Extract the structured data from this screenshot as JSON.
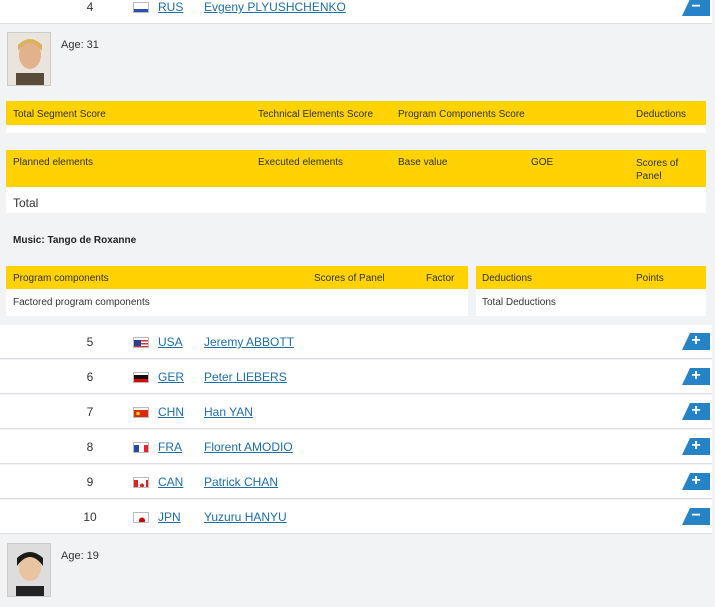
{
  "top_row": {
    "rank": "4",
    "noc": "RUS",
    "name": "Evgeny PLYUSHCHENKO",
    "toggle": "−"
  },
  "detail_plyushchenko": {
    "age": "Age: 31",
    "segment_header": [
      "Total Segment Score",
      "Technical Elements Score",
      "Program Components Score",
      "Deductions"
    ],
    "elements_header": [
      "Planned elements",
      "Executed elements",
      "Base value",
      "GOE",
      "Scores of Panel"
    ],
    "total_label": "Total",
    "music": "Music: Tango de Roxanne",
    "components_header": [
      "Program components",
      "Scores of Panel",
      "Factor"
    ],
    "components_row": "Factored program components",
    "deductions_header": [
      "Deductions",
      "Points"
    ],
    "deductions_row": "Total Deductions"
  },
  "rows": [
    {
      "rank": "5",
      "noc": "USA",
      "name": "Jeremy ABBOTT",
      "toggle": "+",
      "flag": "usa"
    },
    {
      "rank": "6",
      "noc": "GER",
      "name": "Peter LIEBERS",
      "toggle": "+",
      "flag": "ger"
    },
    {
      "rank": "7",
      "noc": "CHN",
      "name": "Han YAN",
      "toggle": "+",
      "flag": "chn"
    },
    {
      "rank": "8",
      "noc": "FRA",
      "name": "Florent AMODIO",
      "toggle": "+",
      "flag": "fra"
    },
    {
      "rank": "9",
      "noc": "CAN",
      "name": "Patrick CHAN",
      "toggle": "+",
      "flag": "can"
    },
    {
      "rank": "10",
      "noc": "JPN",
      "name": "Yuzuru HANYU",
      "toggle": "−",
      "flag": "jpn"
    }
  ],
  "detail_hanyu": {
    "age": "Age: 19"
  },
  "colors": {
    "accent": "#ffd200",
    "link": "#1f6ea8",
    "toggle": "#2583c6"
  }
}
